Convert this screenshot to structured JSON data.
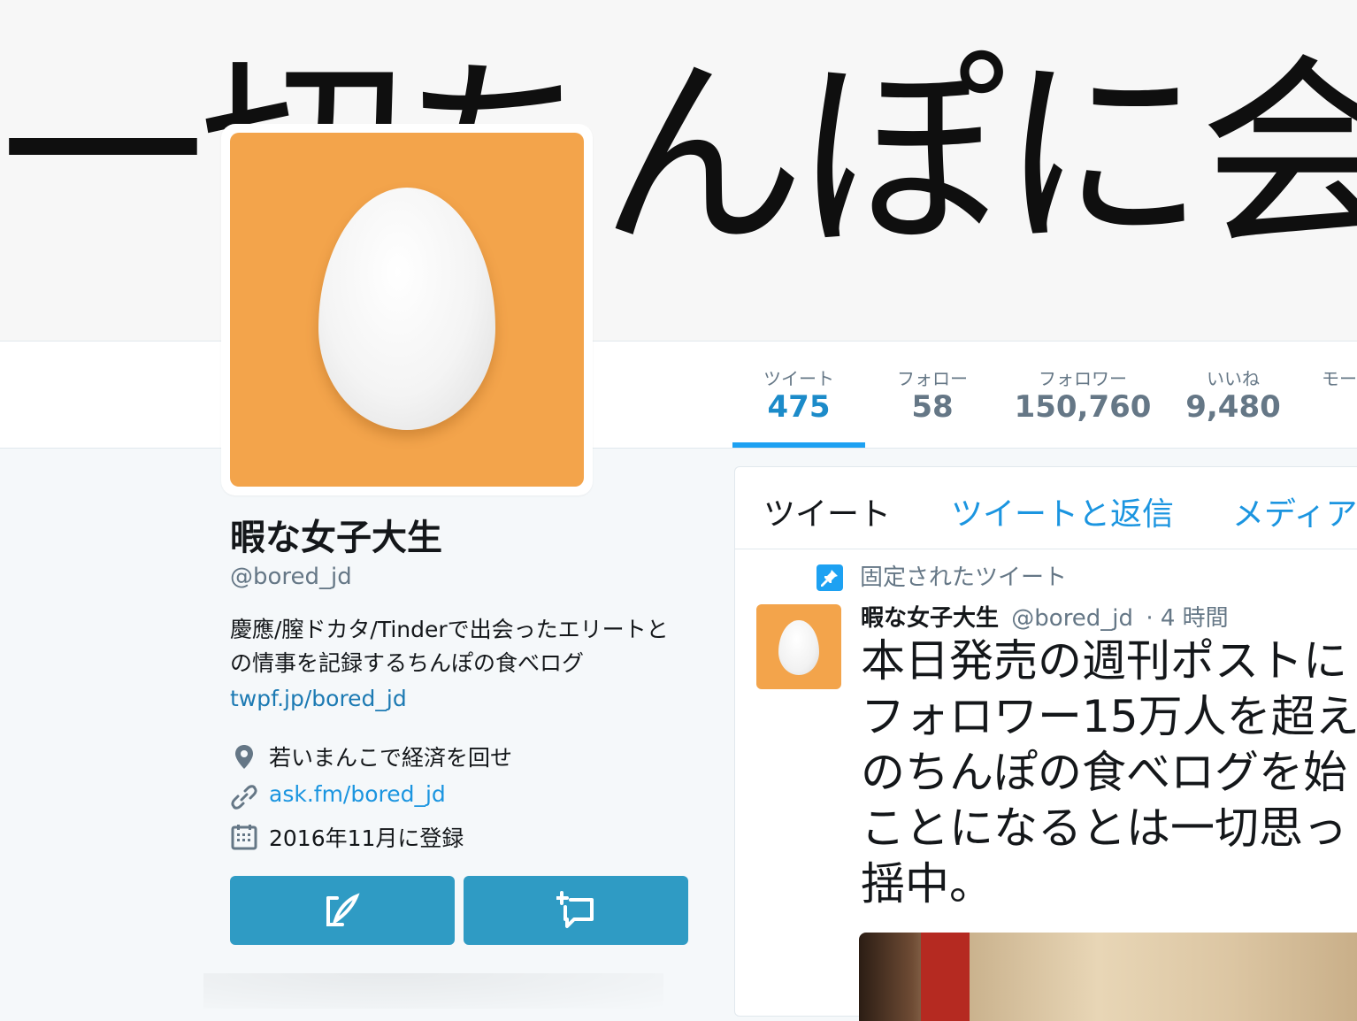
{
  "banner": {
    "text": "一切ちんぽに会い"
  },
  "nav": {
    "stats": [
      {
        "label": "ツイート",
        "value": "475",
        "active": true
      },
      {
        "label": "フォロー",
        "value": "58"
      },
      {
        "label": "フォロワー",
        "value": "150,760"
      },
      {
        "label": "いいね",
        "value": "9,480"
      },
      {
        "label": "モー",
        "value": ""
      }
    ]
  },
  "profile": {
    "name": "暇な女子大生",
    "handle": "@bored_jd",
    "bio": "慶應/膣ドカタ/Tinderで出会ったエリートとの情事を記録するちんぽの食べログ",
    "bio_link": "twpf.jp/bored_jd",
    "location": "若いまんこで経済を回せ",
    "website": "ask.fm/bored_jd",
    "joined": "2016年11月に登録",
    "icons": {
      "location": "map-pin-icon",
      "website": "link-icon",
      "joined": "calendar-icon",
      "tweet_to": "compose-icon",
      "message": "direct-message-icon"
    }
  },
  "timeline": {
    "tabs": [
      "ツイート",
      "ツイートと返信",
      "メディア"
    ],
    "pinned_label": "固定されたツイート",
    "tweet": {
      "name": "暇な女子大生",
      "handle": "@bored_jd",
      "time": "· 4 時間",
      "text": "本日発売の週刊ポストに\nフォロワー15万人を超え\nのちんぽの食べログを始\nことになるとは一切思っ\n揺中。"
    }
  },
  "colors": {
    "accent": "#1da1f2",
    "avatar_bg": "#f3a44b",
    "button": "#2f9bc4"
  }
}
